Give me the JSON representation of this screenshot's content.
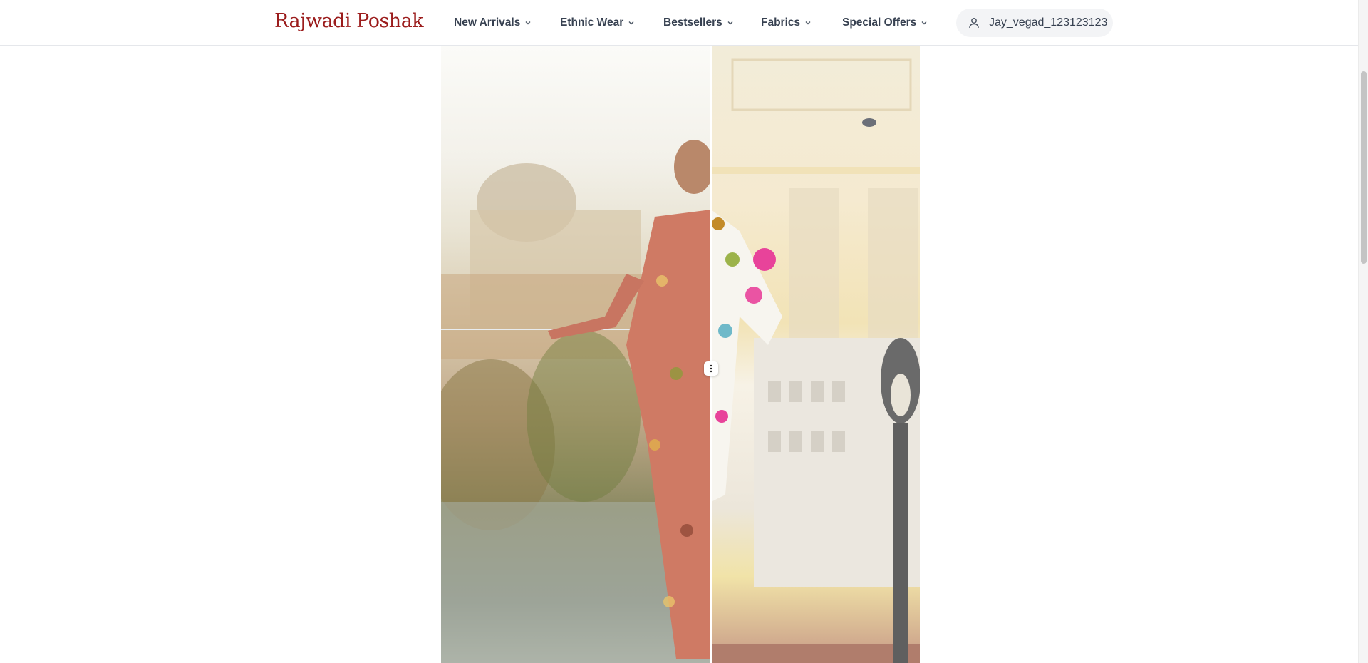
{
  "brand": {
    "name": "Rajwadi Poshak",
    "color": "#9b1c1c"
  },
  "nav": {
    "items": [
      {
        "label": "New Arrivals"
      },
      {
        "label": "Ethnic Wear"
      },
      {
        "label": "Bestsellers"
      },
      {
        "label": "Fabrics"
      },
      {
        "label": "Special Offers"
      }
    ]
  },
  "user": {
    "username": "Jay_vegad_123123123",
    "icon": "user-icon"
  },
  "hero": {
    "type": "before-after-image-compare",
    "left_image": "coral floral print kurta and palazzo set, palace terrace background",
    "right_image": "white kurta with pink and green floral print, yellow palace wall with white balustrade",
    "divider_icon": "vertical-dots-icon"
  }
}
